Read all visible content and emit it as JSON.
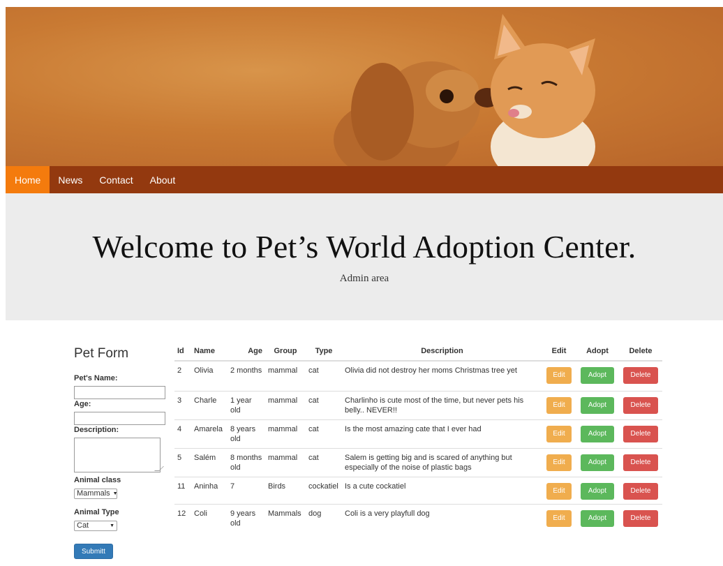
{
  "nav": {
    "items": [
      {
        "label": "Home",
        "active": true
      },
      {
        "label": "News",
        "active": false
      },
      {
        "label": "Contact",
        "active": false
      },
      {
        "label": "About",
        "active": false
      }
    ]
  },
  "hero": {
    "title": "Welcome to Pet’s World Adoption Center.",
    "subtitle": "Admin area"
  },
  "form": {
    "title": "Pet Form",
    "name_label": "Pet's Name:",
    "age_label": "Age:",
    "description_label": "Description:",
    "class_label": "Animal class",
    "class_value": "Mammals",
    "type_label": "Animal Type",
    "type_value": "Cat",
    "submit_label": "Submitt"
  },
  "table": {
    "headers": [
      "Id",
      "Name",
      "Age",
      "Group",
      "Type",
      "Description",
      "Edit",
      "Adopt",
      "Delete"
    ],
    "edit_label": "Edit",
    "adopt_label": "Adopt",
    "delete_label": "Delete",
    "rows": [
      {
        "id": "2",
        "name": "Olivia",
        "age": "2 months",
        "group": "mammal",
        "type": "cat",
        "description": "Olivia did not destroy her moms Christmas tree yet"
      },
      {
        "id": "3",
        "name": "Charle",
        "age": "1 year old",
        "group": "mammal",
        "type": "cat",
        "description": "Charlinho is cute most of the time, but never pets his belly.. NEVER!!"
      },
      {
        "id": "4",
        "name": "Amarela",
        "age": "8 years old",
        "group": "mammal",
        "type": "cat",
        "description": "Is the most amazing cate that I ever had"
      },
      {
        "id": "5",
        "name": "Salém",
        "age": "8 months old",
        "group": "mammal",
        "type": "cat",
        "description": "Salem is getting big and is scared of anything but especially of the noise of plastic bags"
      },
      {
        "id": "11",
        "name": "Aninha",
        "age": "7",
        "group": "Birds",
        "type": "cockatiel",
        "description": "Is a cute cockatiel"
      },
      {
        "id": "12",
        "name": "Coli",
        "age": "9 years old",
        "group": "Mammals",
        "type": "dog",
        "description": "Coli is a very playfull dog"
      }
    ]
  },
  "colors": {
    "nav_bg": "#93390f",
    "nav_active": "#f47b0d",
    "edit": "#f0ad4e",
    "adopt": "#5cb85c",
    "delete": "#d9534f",
    "submit": "#337ab7"
  }
}
